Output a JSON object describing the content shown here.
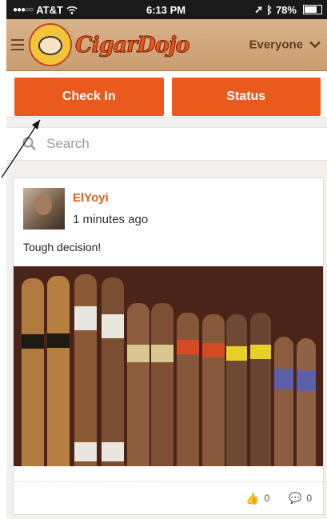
{
  "status_bar": {
    "carrier": "AT&T",
    "time": "6:13 PM",
    "battery": "78%",
    "battery_level": 0.78
  },
  "navbar": {
    "logo_text": "CigarDojo",
    "audience_label": "Everyone"
  },
  "actions": {
    "check_in_label": "Check In",
    "status_label": "Status"
  },
  "search": {
    "placeholder": "Search"
  },
  "post": {
    "username": "ElYoyi",
    "timestamp": "1 minutes ago",
    "text": "Tough decision!",
    "likes": "0",
    "comments": "0"
  },
  "colors": {
    "accent": "#ea5a1c",
    "username": "#e0601f",
    "navbar": "#c99c6e"
  }
}
